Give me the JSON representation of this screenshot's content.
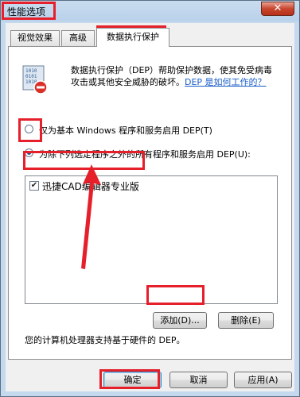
{
  "window": {
    "title": "性能选项",
    "close_icon": "✕"
  },
  "tabs": [
    "视觉效果",
    "高级",
    "数据执行保护"
  ],
  "description": {
    "text": "数据执行保护（DEP）帮助保护数据，使其免受病毒攻击或其他安全威胁的破坏。",
    "link": "DEP 是如何工作的？"
  },
  "options": {
    "basic": "仅为基本 Windows 程序和服务启用 DEP(T)",
    "all_except": "为除下列选定程序之外的所有程序和服务启用 DEP(U):",
    "selected": "all_except"
  },
  "program_list": [
    {
      "label": "迅捷CAD编辑器专业版",
      "checked": true
    }
  ],
  "buttons": {
    "add": "添加(D)...",
    "remove": "删除(E)",
    "ok": "确定",
    "cancel": "取消",
    "apply": "应用(A)"
  },
  "footer_text": "您的计算机处理器支持基于硬件的 DEP。",
  "colors": {
    "highlight": "#e5202b",
    "link": "#1a5dc8"
  }
}
